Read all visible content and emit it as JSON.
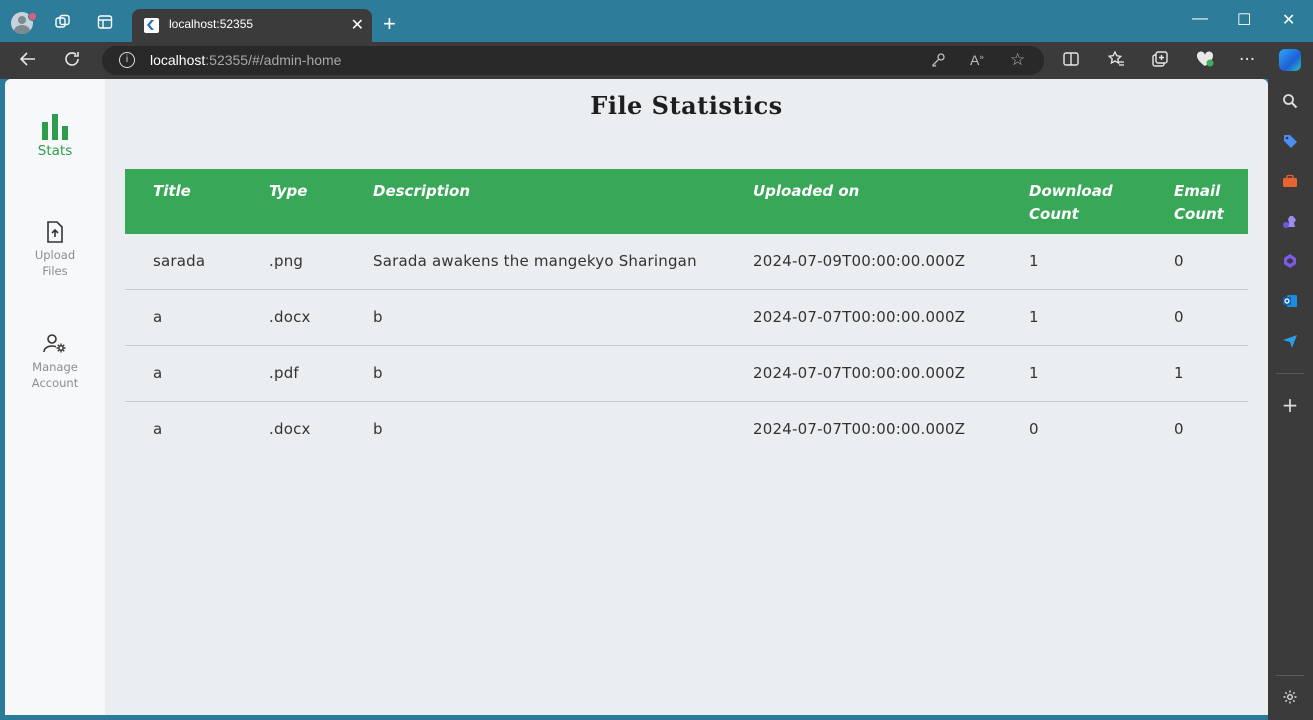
{
  "browser": {
    "tab_title": "localhost:52355",
    "url_host": "localhost",
    "url_rest": ":52355/#/admin-home"
  },
  "sidebar": {
    "items": [
      {
        "label": "Stats",
        "icon": "bar-chart-icon",
        "active": true
      },
      {
        "label": "Upload\nFiles",
        "icon": "upload-file-icon",
        "active": false
      },
      {
        "label": "Manage\nAccount",
        "icon": "manage-account-icon",
        "active": false
      }
    ]
  },
  "page": {
    "title": "File Statistics"
  },
  "table": {
    "headers": [
      "Title",
      "Type",
      "Description",
      "Uploaded on",
      "Download Count",
      "Email Count"
    ],
    "rows": [
      [
        "sarada",
        ".png",
        "Sarada awakens the mangekyo Sharingan",
        "2024-07-09T00:00:00.000Z",
        "1",
        "0"
      ],
      [
        "a",
        ".docx",
        "b",
        "2024-07-07T00:00:00.000Z",
        "1",
        "0"
      ],
      [
        "a",
        ".pdf",
        "b",
        "2024-07-07T00:00:00.000Z",
        "1",
        "1"
      ],
      [
        "a",
        ".docx",
        "b",
        "2024-07-07T00:00:00.000Z",
        "0",
        "0"
      ]
    ]
  },
  "colors": {
    "accent": "#38a757",
    "browser_frame": "#2c7c9a",
    "page_background": "#ebeef0",
    "rail_background": "#f7f8fa"
  }
}
